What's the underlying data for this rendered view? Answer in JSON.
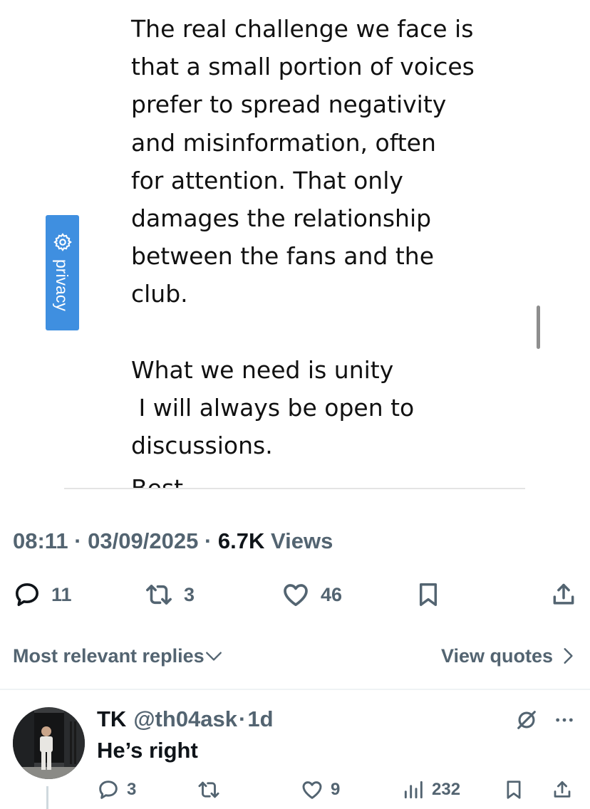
{
  "embedded_post": {
    "paragraph1": [
      "The real challenge we face is",
      "that a small portion of voices",
      "prefer to spread negativity",
      "and misinformation, often",
      "for attention. That only",
      "damages the relationship",
      "between the fans and the",
      "club."
    ],
    "paragraph2": [
      "What we need is unity",
      " I will always be open to",
      "discussions."
    ],
    "cut_off_line": "Best",
    "privacy_tab_label": "privacy"
  },
  "tweet_meta": {
    "time": "08:11",
    "separator": "·",
    "date": "03/09/2025",
    "views_count": "6.7K",
    "views_label": "Views"
  },
  "tweet_actions": {
    "replies": "11",
    "reposts": "3",
    "likes": "46"
  },
  "replies_bar": {
    "sort_label": "Most relevant replies",
    "quotes_label": "View quotes"
  },
  "reply": {
    "name": "TK",
    "handle": "@th04ask",
    "separator": "·",
    "time": "1d",
    "text": "He’s right",
    "replies": "3",
    "likes": "9",
    "views": "232"
  },
  "icons": {
    "reply": "speech-bubble-icon",
    "repost": "repost-arrows-icon",
    "like": "heart-icon",
    "bookmark": "bookmark-icon",
    "share": "share-icon",
    "views": "bar-chart-icon",
    "grok": "grok-slash-icon",
    "more": "more-dots-icon",
    "settings": "gear-icon"
  },
  "colors": {
    "secondary_text": "#536471",
    "primary_text": "#0f1419",
    "privacy_tab": "#3f8fe0"
  }
}
